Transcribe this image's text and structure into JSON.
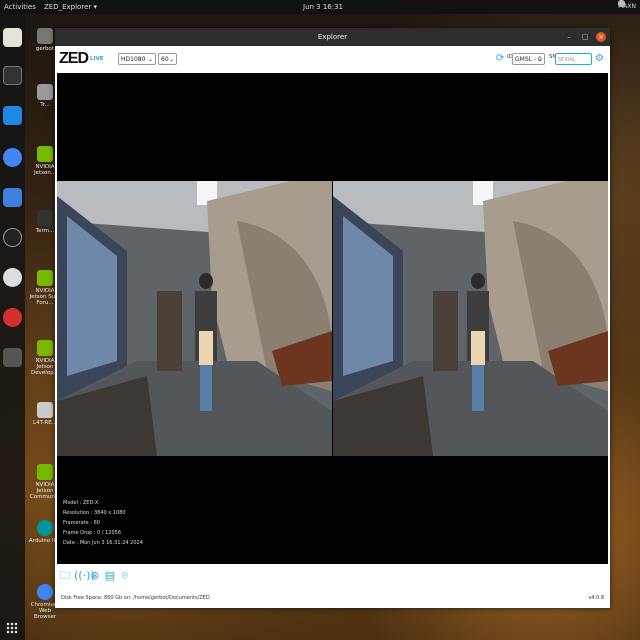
{
  "topbar": {
    "activities": "Activities",
    "app_menu": "ZED_Explorer ▾",
    "clock": "Jun 3 16:31",
    "user": "MAXN"
  },
  "desktop_icons": [
    {
      "label": "gerbot"
    },
    {
      "label": "Tr..."
    },
    {
      "label": "NVIDIA Jetson..."
    },
    {
      "label": "Term..."
    },
    {
      "label": "NVIDIA Jetson Su... Foru..."
    },
    {
      "label": "NVIDIA Jetson Develop..."
    },
    {
      "label": "L4T-RE..."
    },
    {
      "label": "NVIDIA Jetson Commun..."
    },
    {
      "label": "Arduino IDE"
    },
    {
      "label": "Chromium Web Browser"
    }
  ],
  "window": {
    "title": "Explorer",
    "minimize": "–",
    "maximize": "□",
    "close": "×"
  },
  "toolbar": {
    "logo": "ZED",
    "live": "LIVE",
    "resolution": "HD1080",
    "fps": "60",
    "id_label": "ID",
    "id_value": "GMSL - 0",
    "sn_label": "SN",
    "sn_placeholder": "SERIAL"
  },
  "overlay": {
    "model": "Model : ZED-X",
    "resolution": "Resolution : 3840 x 1080",
    "framerate": "Framerate : 60",
    "frame_drop": "Frame Drop : 0 / 12056",
    "date": "Date : Mon Jun 3 16:31:24 2024"
  },
  "status": {
    "disk": "Disk Free Space: 860 Gb  on: /home/gerbot/Documents/ZED",
    "version": "v4.0.8"
  },
  "colors": {
    "accent": "#2aa9d8",
    "close_button": "#e95420"
  },
  "icons": [
    "folder-icon",
    "broadcast-icon",
    "settings-icon",
    "film-icon",
    "camera-icon",
    "refresh-icon",
    "gear-icon"
  ]
}
